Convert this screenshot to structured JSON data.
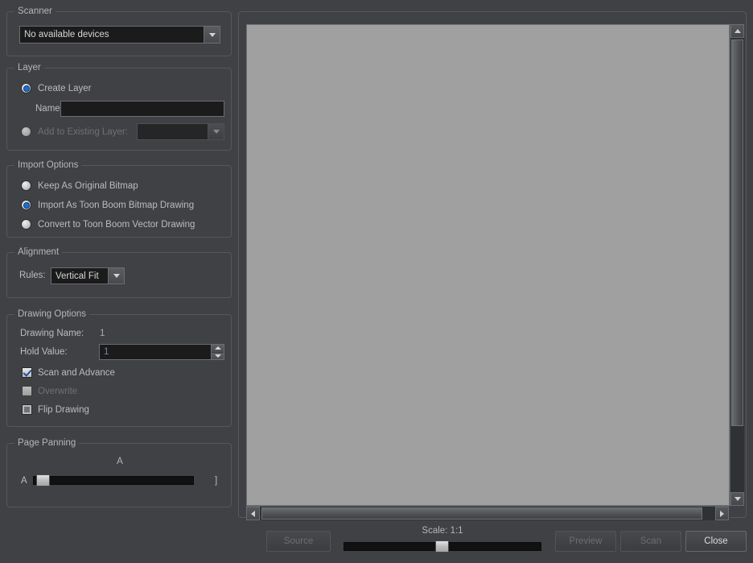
{
  "dialog": {
    "background": "#3f4145"
  },
  "scanner": {
    "group_title": "Scanner",
    "device_value": "No available devices"
  },
  "layer": {
    "group_title": "Layer",
    "create_layer_label": "Create Layer",
    "name_label": "Name:",
    "name_value": "",
    "add_existing_label": "Add to Existing Layer:",
    "add_existing_value": ""
  },
  "import_options": {
    "group_title": "Import Options",
    "options": [
      {
        "label": "Keep As Original Bitmap",
        "selected": false
      },
      {
        "label": "Import As Toon Boom Bitmap Drawing",
        "selected": true
      },
      {
        "label": "Convert to Toon Boom Vector Drawing",
        "selected": false
      }
    ]
  },
  "alignment": {
    "group_title": "Alignment",
    "rules_label": "Rules:",
    "rules_value": "Vertical Fit"
  },
  "drawing_options": {
    "group_title": "Drawing Options",
    "drawing_name_label": "Drawing Name:",
    "drawing_name_value": "1",
    "hold_value_label": "Hold Value:",
    "hold_value": "1",
    "scan_and_advance_label": "Scan and Advance",
    "overwrite_label": "Overwrite",
    "flip_drawing_label": "Flip Drawing"
  },
  "page_panning": {
    "group_title": "Page Panning",
    "top_marker": "A",
    "left_marker": "A",
    "right_marker": "]",
    "handle_percent": 2
  },
  "preview": {
    "scroll_v_thumb_percent": 0,
    "scroll_h_thumb_percent": 0
  },
  "footer": {
    "source_label": "Source",
    "scale_label": "Scale: 1:1",
    "scale_handle_percent": 49,
    "preview_label": "Preview",
    "scan_label": "Scan",
    "close_label": "Close"
  }
}
